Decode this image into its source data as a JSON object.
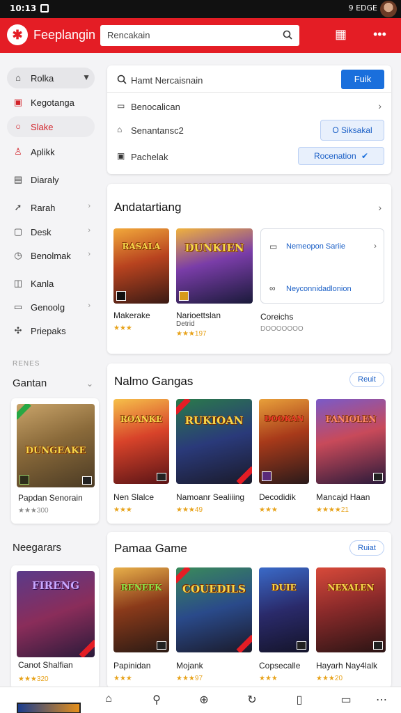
{
  "status_bar": {
    "time": "10:13",
    "right_text": "9 EDGE"
  },
  "app_bar": {
    "brand": "Feeplangin",
    "search_placeholder": "Rencakain",
    "icons": [
      "logo-icon",
      "search-icon",
      "grid-icon",
      "more-icon"
    ]
  },
  "sidebar": {
    "items": [
      {
        "label": "Rolka",
        "icon": "home-icon",
        "chevron": "down"
      },
      {
        "label": "Kegotanga",
        "icon": "briefcase-icon"
      },
      {
        "label": "Slake",
        "icon": "chat-icon"
      },
      {
        "label": "Aplikk",
        "icon": "user-icon"
      },
      {
        "label": "Diaraly",
        "icon": "calendar-icon"
      },
      {
        "label": "Rarah",
        "icon": "rocket-icon",
        "chevron": "right"
      },
      {
        "label": "Desk",
        "icon": "box-icon",
        "chevron": "right"
      },
      {
        "label": "Benolmak",
        "icon": "clock-icon",
        "chevron": "right"
      },
      {
        "label": "Kanla",
        "icon": "map-icon"
      },
      {
        "label": "Genoolg",
        "icon": "folder-icon",
        "chevron": "right"
      },
      {
        "label": "Priepaks",
        "icon": "puzzle-icon"
      }
    ],
    "section_label": "RENES",
    "section1_title": "Gantan",
    "section1_card": {
      "name": "Papdan Senorain",
      "rating": "★★★300",
      "cover_title": "DUNGEAKE"
    },
    "section2_title": "Neegarars",
    "section2_card": {
      "name": "Canot Shalfian",
      "rating": "★★★320",
      "cover_title": "FIRENG"
    }
  },
  "filters": {
    "search_text": "Hamt Nercaisnain",
    "search_button": "Fuik",
    "rows": [
      {
        "label": "Benocalican",
        "icon": "folder-icon"
      },
      {
        "label": "Senantansc2",
        "icon": "home-icon",
        "button": "O Siksakal"
      },
      {
        "label": "Pachelak",
        "icon": "image-icon",
        "button": "Rocenation"
      }
    ]
  },
  "section_featured": {
    "title": "Andatartiang",
    "games": [
      {
        "name": "Makerake",
        "rating": "★★★",
        "cover_title": "RASALA"
      },
      {
        "name": "Narioettslan",
        "subtitle": "Detrid",
        "rating": "★★★197",
        "cover_title": "DUNKIEN"
      }
    ],
    "rec_box": {
      "item1": "Nemeopon Sariie",
      "item2": "Neyconnidadlonion",
      "caption": "Coreichs",
      "caption_sub": "DOOOOOOO"
    }
  },
  "section_sale": {
    "title": "Nalmo Gangas",
    "action": "Reuit",
    "games": [
      {
        "name": "Nen Slalce",
        "rating": "★★★",
        "cover_title": "ROANKE"
      },
      {
        "name": "Namoanr Sealiiing",
        "rating": "★★★49",
        "cover_title": "RUKIOAN"
      },
      {
        "name": "Decodidik",
        "rating": "★★★",
        "cover_title": "DOOKAN"
      },
      {
        "name": "Mancajd Haan",
        "rating": "★★★★21",
        "cover_title": "FANIOLEN"
      }
    ]
  },
  "section_games": {
    "title": "Pamaa Game",
    "action": "Ruiat",
    "games": [
      {
        "name": "Papinidan",
        "rating": "★★★",
        "cover_title": "RENEEK"
      },
      {
        "name": "Mojank",
        "rating": "★★★97",
        "cover_title": "COUEDILS"
      },
      {
        "name": "Copsecalle",
        "rating": "★★★",
        "cover_title": "DUIE"
      },
      {
        "name": "Hayarh Nay4lalk",
        "rating": "★★★20",
        "cover_title": "NEXALEN"
      }
    ]
  },
  "bottom_nav": [
    "home-icon",
    "search-icon",
    "add-icon",
    "refresh-icon",
    "bookmark-icon",
    "window-icon",
    "more-icon"
  ],
  "colors": {
    "brand_red": "#e41d25",
    "accent_blue": "#1a6fdc",
    "star": "#e7a21a"
  }
}
